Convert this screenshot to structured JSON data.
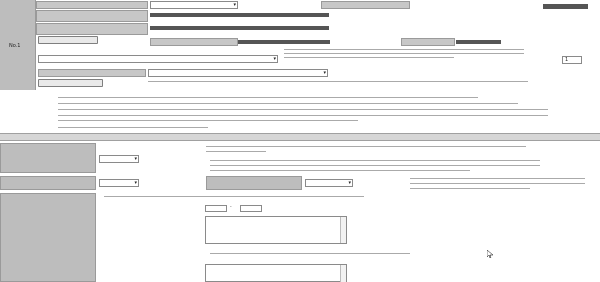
{
  "header_rows": {
    "row_company_type": "",
    "row_trade_name": "",
    "row_head_office": "",
    "corp_number_label": "",
    "company_lookup_button": ""
  },
  "rows": {
    "no_label": "No.1",
    "registry_name_label": "",
    "registry_code_label": "",
    "certificate_type_label": "",
    "add_same_request_button": ""
  },
  "form": {
    "items_select": "",
    "cert_select": "",
    "count_value": "1",
    "count_unit": ""
  },
  "sections": {
    "delivery_info": "",
    "delivery_method_label": "",
    "delivery_method_value": "",
    "mail_type_label": "",
    "mail_type_value": "",
    "express_label": "",
    "express_value": "",
    "recipient_label": "",
    "postcode_label": "",
    "address_label": "",
    "name_label": ""
  }
}
